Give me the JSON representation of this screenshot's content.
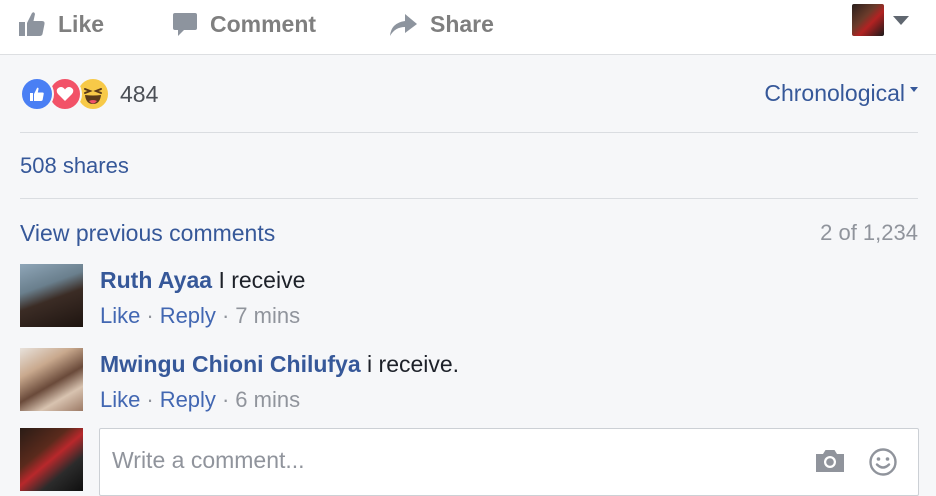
{
  "action_bar": {
    "like_label": "Like",
    "comment_label": "Comment",
    "share_label": "Share",
    "icons": [
      "thumbs-up-icon",
      "speech-bubble-icon",
      "share-arrow-icon"
    ]
  },
  "reactions": {
    "types": [
      "like",
      "love",
      "haha"
    ],
    "count": "484"
  },
  "sort": {
    "label": "Chronological"
  },
  "shares": {
    "label": "508 shares"
  },
  "comments_header": {
    "view_previous": "View previous comments",
    "count": "2 of 1,234"
  },
  "comments": [
    {
      "author": "Ruth Ayaa",
      "text": "I receive",
      "like": "Like",
      "reply": "Reply",
      "time": "7 mins"
    },
    {
      "author": "Mwingu Chioni Chilufya",
      "text": "i receive.",
      "like": "Like",
      "reply": "Reply",
      "time": "6 mins"
    }
  ],
  "composer": {
    "placeholder": "Write a comment...",
    "icons": [
      "camera-icon",
      "smiley-icon"
    ]
  },
  "colors": {
    "link": "#365899",
    "muted": "#90949c",
    "like_blue": "#4a7ff4",
    "love_red": "#f25268",
    "haha_yellow": "#f7c948"
  }
}
